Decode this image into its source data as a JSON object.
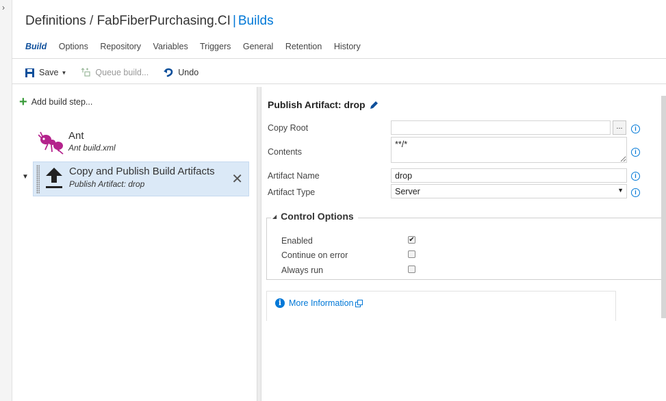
{
  "breadcrumb": {
    "definitions": "Definitions",
    "separator": "/",
    "definition_name": "FabFiberPurchasing.CI",
    "divider": "|",
    "section": "Builds"
  },
  "tabs": [
    "Build",
    "Options",
    "Repository",
    "Variables",
    "Triggers",
    "General",
    "Retention",
    "History"
  ],
  "active_tab": "Build",
  "toolbar": {
    "save_label": "Save",
    "queue_label": "Queue build...",
    "undo_label": "Undo"
  },
  "steps_panel": {
    "add_label": "Add build step...",
    "steps": [
      {
        "name": "Ant",
        "subtitle": "Ant build.xml",
        "icon": "ant-icon"
      },
      {
        "name": "Copy and Publish Build Artifacts",
        "subtitle": "Publish Artifact: drop",
        "icon": "upload-icon",
        "selected": true
      }
    ]
  },
  "detail": {
    "title": "Publish Artifact: drop",
    "fields": {
      "copy_root": {
        "label": "Copy Root",
        "value": ""
      },
      "contents": {
        "label": "Contents",
        "value": "**/*"
      },
      "artifact_name": {
        "label": "Artifact Name",
        "value": "drop"
      },
      "artifact_type": {
        "label": "Artifact Type",
        "value": "Server"
      }
    },
    "browse_label": "...",
    "control_options": {
      "title": "Control Options",
      "options": [
        {
          "label": "Enabled",
          "checked": true
        },
        {
          "label": "Continue on error",
          "checked": false
        },
        {
          "label": "Always run",
          "checked": false
        }
      ]
    },
    "more_info_label": "More Information"
  },
  "colors": {
    "accent": "#0078d7",
    "selected_step_bg": "#dbe9f7",
    "add_green": "#3a9b3a",
    "ant_magenta": "#b4238c"
  }
}
